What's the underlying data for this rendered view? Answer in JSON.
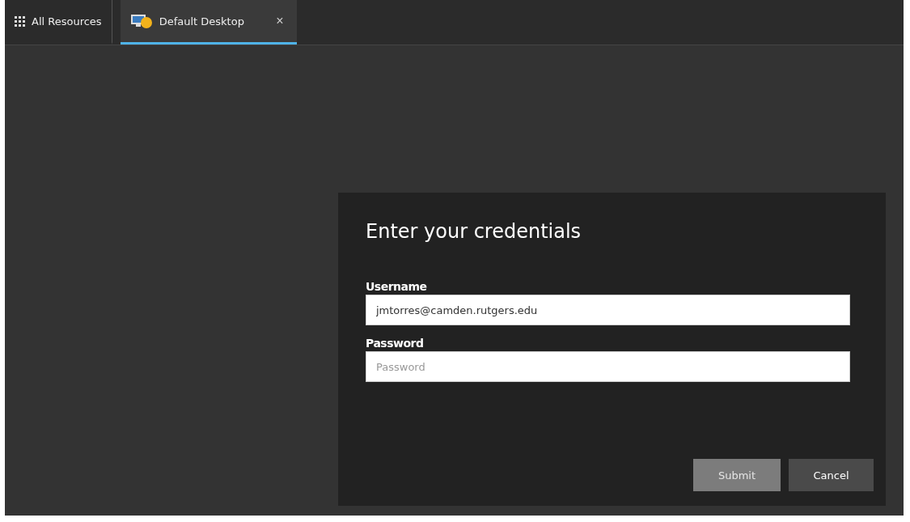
{
  "tabs": [
    {
      "kind": "launcher",
      "label": "All Resources",
      "selected": false
    },
    {
      "kind": "session",
      "label": "Default Desktop",
      "selected": true,
      "close": "×"
    }
  ],
  "dialog": {
    "title": "Enter your credentials",
    "fields": [
      {
        "label": "Username",
        "value": "jmtorres@camden.rutgers.edu"
      },
      {
        "label": "Password",
        "placeholder": "Password"
      }
    ],
    "buttons": [
      {
        "label": "Submit",
        "disabled": true
      },
      {
        "label": "Cancel",
        "disabled": false
      }
    ]
  }
}
